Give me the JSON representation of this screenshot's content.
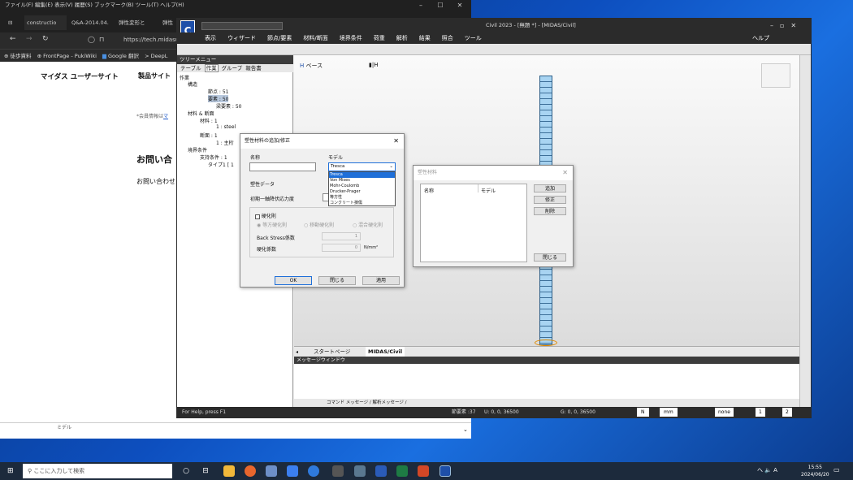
{
  "browser": {
    "menu": "ファイル(F)  編集(E)  表示(V)  履歴(S)  ブックマーク(B)  ツール(T)  ヘルプ(H)",
    "win_min": "–",
    "win_max": "☐",
    "win_close": "✕",
    "tabs": [
      "constructio",
      "Q&A-2014.04.",
      "弾性変形と",
      "弾性"
    ],
    "address": "https://tech.midasu",
    "bookmarks": [
      "⊕ 徒歩資料",
      "⊕ FrontPage - PukiWiki",
      "Google 翻訳",
      "> DeepL"
    ],
    "site_name": "マイダス ユーザーサイト",
    "site_nav": "製品サイト",
    "member_note": "*会員情報は",
    "member_link": "マ",
    "contact_title": "お問い合",
    "contact_text": "お問い合わせ",
    "bottom_text": "ミデル"
  },
  "civil": {
    "title": "Civil 2023 - [無題 *] - [MIDAS/Civil]",
    "menu": [
      "表示",
      "ウィザード",
      "節点/要素",
      "材料/断面",
      "境界条件",
      "荷重",
      "解析",
      "結果",
      "照合",
      "ツール"
    ],
    "help": "ヘルプ",
    "tree_header": "ツリーメニュー",
    "tree_tabs": [
      "テーブル",
      "作業",
      "グループ",
      "報告書"
    ],
    "tree": [
      {
        "text": "作業"
      },
      {
        "text": "構造"
      },
      {
        "text": "節点 : 51"
      },
      {
        "text": "要素 : 50"
      },
      {
        "text": "梁要素 : 50"
      },
      {
        "text": "材料 & 断面"
      },
      {
        "text": "材料 : 1"
      },
      {
        "text": "1 : steel"
      },
      {
        "text": "断面 : 1"
      },
      {
        "text": "1 : 主桁"
      },
      {
        "text": "境界条件"
      },
      {
        "text": "支持条件 : 1"
      },
      {
        "text": "タイプ1 [ 1"
      }
    ],
    "view_label": "ベース",
    "doc_tabs": [
      "スタートページ",
      "MIDAS/Civil"
    ],
    "message_header": "メッセージウィンドウ",
    "msg_tabs": "コマンド メッセージ / 解析メッセージ /",
    "status_help": "For Help, press F1",
    "status_elem": "節要素 :37",
    "status_u": "U: 0, 0, 36500",
    "status_g": "G: 0, 0, 36500",
    "unit_force": "N",
    "unit_len": "mm",
    "status_mode": "none",
    "page": "1",
    "page_total": "2"
  },
  "plastic_dialog": {
    "title": "塑性材料の追加/修正",
    "name_label": "名称",
    "name_value": "",
    "model_label": "モデル",
    "model_selected": "Tresca",
    "model_options": [
      "Tresca",
      "Von Mises",
      "Mohr-Coulomb",
      "Drucker-Prager",
      "等方性",
      "コンクリート損傷"
    ],
    "data_label": "塑性データ",
    "yield_label": "初期一軸降伏応力度",
    "hardening_label": "硬化則",
    "radio_isotropic": "等方硬化則",
    "radio_kinematic": "移動硬化則",
    "radio_mixed": "混合硬化則",
    "backstress_label": "Back Stress係数",
    "backstress_value": "1",
    "hardcoef_label": "硬化係数",
    "hardcoef_value": "0",
    "hardcoef_unit": "N/mm²",
    "ok": "OK",
    "close": "閉じる",
    "apply": "適用"
  },
  "material_dialog": {
    "title": "塑性材料",
    "col_name": "名称",
    "col_model": "モデル",
    "add": "追加",
    "edit": "修正",
    "delete": "削除",
    "close": "閉じる"
  },
  "taskbar": {
    "search": "ここに入力して検索",
    "time": "15:55",
    "date": "2024/06/20",
    "tray": "へ 🔈 A"
  }
}
